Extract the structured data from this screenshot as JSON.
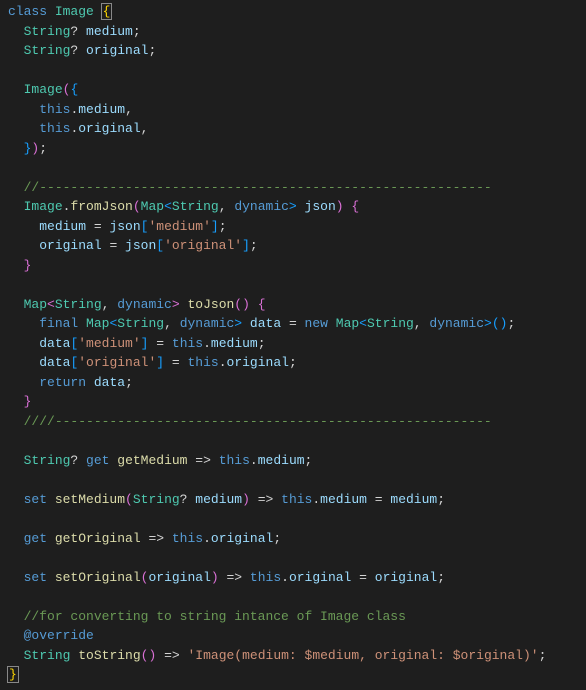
{
  "lines": {
    "l1_class": "class",
    "l1_name": "Image",
    "l1_brace": "{",
    "l2_type": "String",
    "l2_q": "?",
    "l2_var": "medium",
    "l2_semi": ";",
    "l3_type": "String",
    "l3_q": "?",
    "l3_var": "original",
    "l3_semi": ";",
    "l5_ctor": "Image",
    "l5_paren": "(",
    "l5_brace": "{",
    "l6_this": "this",
    "l6_dot": ".",
    "l6_var": "medium",
    "l6_comma": ",",
    "l7_this": "this",
    "l7_dot": ".",
    "l7_var": "original",
    "l7_comma": ",",
    "l8_brace": "}",
    "l8_paren": ")",
    "l8_semi": ";",
    "l10_comment": "//----------------------------------------------------------",
    "l11_cls": "Image",
    "l11_dot": ".",
    "l11_fn": "fromJson",
    "l11_op": "(",
    "l11_map": "Map",
    "l11_lt": "<",
    "l11_str": "String",
    "l11_comma": ", ",
    "l11_dyn": "dynamic",
    "l11_gt": ">",
    "l11_json": "json",
    "l11_cp": ")",
    "l11_ob": "{",
    "l12_var": "medium",
    "l12_eq": " = ",
    "l12_json": "json",
    "l12_ob": "[",
    "l12_str": "'medium'",
    "l12_cb": "]",
    "l12_semi": ";",
    "l13_var": "original",
    "l13_eq": " = ",
    "l13_json": "json",
    "l13_ob": "[",
    "l13_str": "'original'",
    "l13_cb": "]",
    "l13_semi": ";",
    "l14_brace": "}",
    "l16_map": "Map",
    "l16_lt": "<",
    "l16_str": "String",
    "l16_comma": ", ",
    "l16_dyn": "dynamic",
    "l16_gt": ">",
    "l16_fn": "toJson",
    "l16_op": "(",
    "l16_cp": ")",
    "l16_ob": "{",
    "l17_final": "final",
    "l17_map": "Map",
    "l17_lt": "<",
    "l17_str": "String",
    "l17_comma": ", ",
    "l17_dyn": "dynamic",
    "l17_gt": ">",
    "l17_var": "data",
    "l17_eq": " = ",
    "l17_new": "new",
    "l17_map2": "Map",
    "l17_lt2": "<",
    "l17_str2": "String",
    "l17_comma2": ", ",
    "l17_dyn2": "dynamic",
    "l17_gt2": ">",
    "l17_p": "()",
    "l17_semi": ";",
    "l18_var": "data",
    "l18_ob": "[",
    "l18_str": "'medium'",
    "l18_cb": "]",
    "l18_eq": " = ",
    "l18_this": "this",
    "l18_dot": ".",
    "l18_prop": "medium",
    "l18_semi": ";",
    "l19_var": "data",
    "l19_ob": "[",
    "l19_str": "'original'",
    "l19_cb": "]",
    "l19_eq": " = ",
    "l19_this": "this",
    "l19_dot": ".",
    "l19_prop": "original",
    "l19_semi": ";",
    "l20_return": "return",
    "l20_var": "data",
    "l20_semi": ";",
    "l21_brace": "}",
    "l22_comment": "////--------------------------------------------------------",
    "l24_type": "String",
    "l24_q": "?",
    "l24_get": "get",
    "l24_fn": "getMedium",
    "l24_arrow": " => ",
    "l24_this": "this",
    "l24_dot": ".",
    "l24_prop": "medium",
    "l24_semi": ";",
    "l26_set": "set",
    "l26_fn": "setMedium",
    "l26_op": "(",
    "l26_type": "String",
    "l26_q": "?",
    "l26_param": "medium",
    "l26_cp": ")",
    "l26_arrow": " => ",
    "l26_this": "this",
    "l26_dot": ".",
    "l26_prop": "medium",
    "l26_eq": " = ",
    "l26_var": "medium",
    "l26_semi": ";",
    "l28_get": "get",
    "l28_fn": "getOriginal",
    "l28_arrow": " => ",
    "l28_this": "this",
    "l28_dot": ".",
    "l28_prop": "original",
    "l28_semi": ";",
    "l30_set": "set",
    "l30_fn": "setOriginal",
    "l30_op": "(",
    "l30_param": "original",
    "l30_cp": ")",
    "l30_arrow": " => ",
    "l30_this": "this",
    "l30_dot": ".",
    "l30_prop": "original",
    "l30_eq": " = ",
    "l30_var": "original",
    "l30_semi": ";",
    "l32_comment": "//for converting to string intance of Image class",
    "l33_override": "@override",
    "l34_type": "String",
    "l34_fn": "toString",
    "l34_op": "(",
    "l34_cp": ")",
    "l34_arrow": " => ",
    "l34_str": "'Image(medium: $medium, original: $original)'",
    "l34_semi": ";",
    "l35_brace": "}"
  }
}
